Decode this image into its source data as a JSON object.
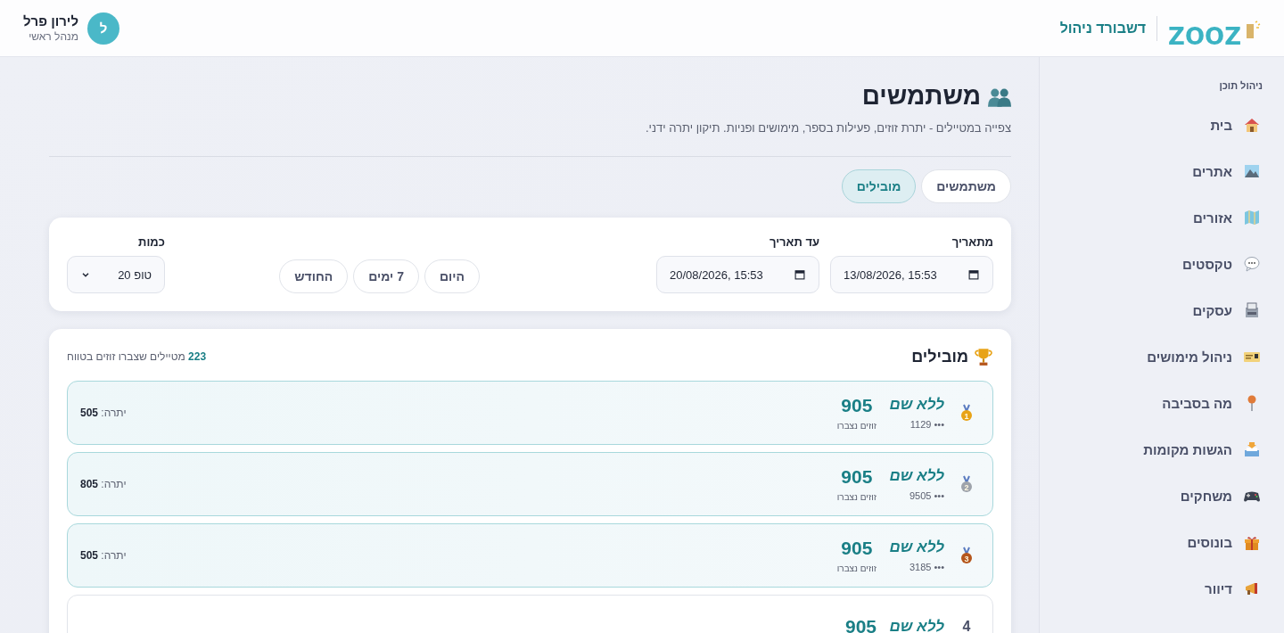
{
  "header": {
    "logo": "ZOOZ",
    "title": "דשבורד ניהול",
    "user": {
      "initial": "ל",
      "name": "לירון פרל",
      "role": "מנהל ראשי"
    }
  },
  "sidebar": {
    "section": "ניהול תוכן",
    "items": [
      {
        "label": "בית",
        "kind": "house"
      },
      {
        "label": "אתרים",
        "kind": "picture"
      },
      {
        "label": "אזורים",
        "kind": "map"
      },
      {
        "label": "טקסטים",
        "kind": "speech"
      },
      {
        "label": "עסקים",
        "kind": "shop"
      },
      {
        "label": "ניהול מימושים",
        "kind": "card"
      },
      {
        "label": "מה בסביבה",
        "kind": "pin"
      },
      {
        "label": "הגשות מקומות",
        "kind": "inbox"
      },
      {
        "label": "משחקים",
        "kind": "gamepad"
      },
      {
        "label": "בונוסים",
        "kind": "gift"
      },
      {
        "label": "דיוור",
        "kind": "megaphone"
      }
    ]
  },
  "page": {
    "title": "משתמשים",
    "subtitle": "צפייה במטיילים - יתרת זוזים, פעילות בספר, מימושים ופניות. תיקון יתרה ידני."
  },
  "tabs": [
    {
      "label": "משתמשים",
      "selected": false
    },
    {
      "label": "מובילים",
      "selected": true
    }
  ],
  "filters": {
    "from": {
      "label": "מתאריך",
      "value": "13/08/2026, 15:53"
    },
    "to": {
      "label": "עד תאריך",
      "value": "20/08/2026, 15:53"
    },
    "ranges": [
      {
        "label": "היום"
      },
      {
        "label": "7 ימים"
      },
      {
        "label": "החודש"
      }
    ],
    "count": {
      "label": "כמות",
      "value": "טופ 20"
    }
  },
  "leaders": {
    "title": "מובילים",
    "summary": "**223** מטיילים שצברו זוזים בטווח",
    "rows": [
      {
        "kind": "medal",
        "color": "#e8a317",
        "rank": "1",
        "highlighted": true,
        "name": "ללא שם",
        "phone": "••• 1129",
        "points": "905",
        "points_label": "זוזים נצברו",
        "balance_label": "יתרה:",
        "balance": "505"
      },
      {
        "kind": "medal",
        "color": "#9ea3ab",
        "rank": "2",
        "highlighted": true,
        "name": "ללא שם",
        "phone": "••• 9505",
        "points": "905",
        "points_label": "זוזים נצברו",
        "balance_label": "יתרה:",
        "balance": "805"
      },
      {
        "kind": "medal",
        "color": "#b5561c",
        "rank": "3",
        "highlighted": true,
        "name": "ללא שם",
        "phone": "••• 3185",
        "points": "905",
        "points_label": "זוזים נצברו",
        "balance_label": "יתרה:",
        "balance": "505"
      },
      {
        "kind": "number",
        "rank": "4",
        "highlighted": false,
        "name": "ללא שם",
        "points": "905"
      }
    ]
  }
}
